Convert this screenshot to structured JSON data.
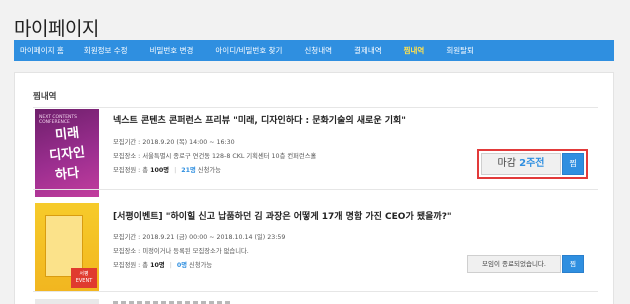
{
  "page": {
    "title": "마이페이지"
  },
  "nav": {
    "items": [
      {
        "label": "마이페이지 홈"
      },
      {
        "label": "회원정보 수정"
      },
      {
        "label": "비밀번호 변경"
      },
      {
        "label": "아이디/비밀번호 찾기"
      },
      {
        "label": "신청내역"
      },
      {
        "label": "결제내역"
      },
      {
        "label": "찜내역",
        "active": true
      },
      {
        "label": "회원탈퇴"
      }
    ]
  },
  "section": {
    "title": "찜내역"
  },
  "items": [
    {
      "title": "넥스트 콘텐츠 콘퍼런스 프리뷰 \"미래, 디자인하다 : 문화기술의 새로운 기회\"",
      "period_label": "모집기간 :",
      "period": "2018.9.20 (목) 14:00 ~ 16:30",
      "place_label": "모집장소 :",
      "place": "서울특별시 종로구 연건동 128-8 CKL 기획센터 10층 컨퍼런스홀",
      "quota_label": "모집정원 : 총",
      "quota": "100명",
      "applied": "21명",
      "applied_suffix": "신청가능",
      "status_prefix": "마감",
      "status_accent": "2주전",
      "zzim": "찜",
      "thumb_lines": [
        "미래",
        "디자인",
        "하다"
      ],
      "thumb_sub": "NEXT CONTENTS CONFERENCE"
    },
    {
      "title": "[서평이벤트] \"하이힐 신고 납품하던 김 과장은 어떻게 17개 명함 가진 CEO가 됐을까?\"",
      "period_label": "모집기간 :",
      "period": "2018.9.21 (금) 00:00 ~ 2018.10.14 (일) 23:59",
      "place_label": "모집장소 :",
      "place": "미정이거나 등록된 모집장소가 없습니다.",
      "quota_label": "모집정원 : 총",
      "quota": "10명",
      "applied": "0명",
      "applied_suffix": "신청가능",
      "status_text": "모임이 종료되었습니다.",
      "zzim": "찜",
      "thumb_badge": "서평 EVENT"
    }
  ],
  "colors": {
    "accent": "#2f8fe0",
    "highlight": "#e23a3a",
    "nav_active": "#ffe14d"
  }
}
